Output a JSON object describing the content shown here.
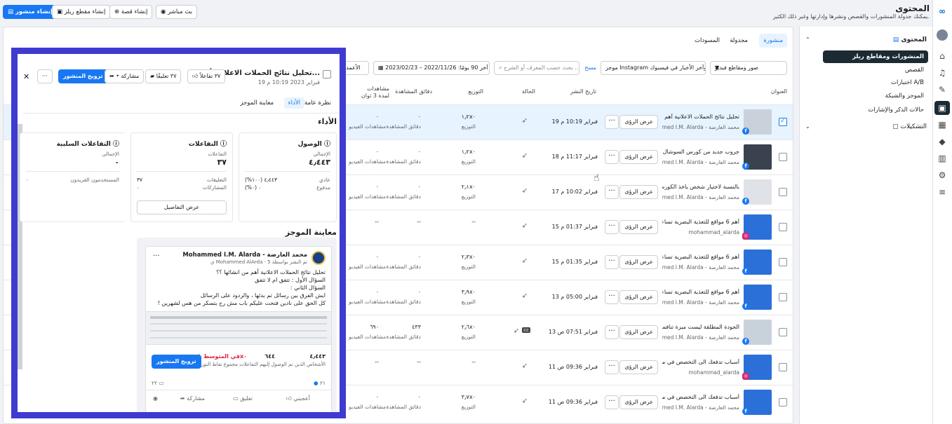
{
  "header": {
    "title": "المحتوى",
    "subtitle": "يمكنك جدولة المنشورات والقصص ونشرها وإدارتها وغير ذلك الكثير.",
    "buttons": {
      "live": "بث مباشر",
      "story": "إنشاء قصة",
      "reel": "إنشاء مقطع ريلز",
      "post": "إنشاء منشور"
    }
  },
  "sidebar": {
    "content_section": "المحتوى",
    "items": [
      "المنشورات ومقاطع ريلز",
      "القصص",
      "اختبارات A/B",
      "الموجز والشبكة",
      "حالات الذكر والإشارات"
    ],
    "collections": "التشكيلات"
  },
  "main": {
    "tabs": [
      "منشورة",
      "مجدولة",
      "المسودات"
    ],
    "filters": {
      "type": "صور ومقاطع فيديو",
      "placement": "موجز Instagram وآخر الأخبار في فيسبوك",
      "clear": "مسح",
      "search_placeholder": "بحث حسب المعرف أو الشرح ...",
      "date_range": "آخر 90 يومًا: 2022/11/26 – 2023/02/23",
      "columns": "الأعمدة"
    },
    "columns": {
      "title": "العنوان",
      "date": "تاريخ النشر",
      "status": "الحالة",
      "reach": "التوزيع",
      "minutes": "دقائق المشاهدة",
      "views": "مشاهدات لمدة 3 ثوان"
    },
    "view_insights": "عرض الرؤى",
    "reach_label": "التوزيع",
    "minutes_label": "دقائق المشاهدة",
    "views_label": "مشاهدات الفيديو",
    "rows": [
      {
        "title": "تحليل نتائج الحملات الاعلانية أهم من...",
        "page": "محمد العارضة - Mohammed I.M. Alarda",
        "date": "19 فبراير 10:19 م",
        "reach": "١٫٢x٠",
        "minutes": "٠",
        "views": "٠"
      },
      {
        "title": "جروب جديد من كورس السوشال ميديـ...",
        "page": "محمد العارضة - Mohammed I.M. Alarda",
        "date": "18 فبراير 11:17 م",
        "reach": "١٫٢x٠",
        "minutes": "٠",
        "views": "٠"
      },
      {
        "title": "بالنسبة لاختيار شخص ياخذ الكورس ...",
        "page": "محمد العارضة - Mohammed I.M. Alarda",
        "date": "17 فبراير 10:02 م",
        "reach": "٢٫١x٠",
        "minutes": "٠",
        "views": "٠"
      },
      {
        "title": "أهم 6 مواقع للتعذية البصرية تساعـ...",
        "page": "mohammad_alarda",
        "date": "15 فبراير 01:37 م",
        "reach": "--",
        "minutes": "--",
        "views": "--"
      },
      {
        "title": "أهم 6 مواقع للتعذية البصرية تساعـ...",
        "page": "محمد العارضة - Mohammed I.M. Alarda",
        "date": "15 فبراير 01:35 م",
        "reach": "٢٫٣x٠",
        "minutes": "٠",
        "views": "٠"
      },
      {
        "title": "أهم 6 مواقع للتعذية البصرية تساعـ...",
        "page": "محمد العارضة - Mohammed I.M. Alarda",
        "date": "13 فبراير 05:00 م",
        "reach": "٣٫٩x٠",
        "minutes": "٠",
        "views": "٠"
      },
      {
        "title": "الجودة المطلقة ليست ميزة تنافسية ...",
        "page": "محمد العارضة - Mohammed I.M. Alarda",
        "date": "13 فبراير 07:51 ص",
        "reach": "٢٫٦x٠",
        "minutes": "٤٣٣",
        "views": "٦٩٠"
      },
      {
        "title": "أسباب تدفعك الى التخصص في مج...",
        "page": "mohammad_alarda",
        "date": "11 فبراير 09:36 ص",
        "reach": "--",
        "minutes": "--",
        "views": "--"
      },
      {
        "title": "أسباب تدفعك الى التخصص في مج...",
        "page": "محمد العارضة - Mohammed I.M. Alarda",
        "date": "11 فبراير 09:36 ص",
        "reach": "٣٫٧x٠",
        "minutes": "٠",
        "views": "٠"
      }
    ]
  },
  "panel": {
    "title": "تحليل نتائج الحملات الاعلانية أه...",
    "date": "19 فبراير 2023 10:19 م",
    "reactions": "٣٧ تفاعلاً",
    "comments": "٣٧ تعليقًا",
    "share": "• مشاركة",
    "boost": "ترويج المنشور",
    "tabs": [
      "نظرة عامة",
      "الأداء",
      "معاينة الموجز"
    ],
    "performance_heading": "الأداء",
    "reach": {
      "title": "الوصول",
      "total_label": "الإجمالي",
      "total": "٤٫٤٤٣",
      "organic_label": "عادي",
      "organic": "٤٫٤٤٣ (١٠٠%)",
      "paid_label": "مدفوع",
      "paid": "٠ (٠%)"
    },
    "engagement": {
      "title": "التفاعلات",
      "total_label": "التفاعلات",
      "total": "٣٧",
      "comments_label": "التعليقات",
      "comments": "٣٧",
      "shares_label": "المشاركات",
      "shares": "٠",
      "details": "عرض التفاصيل"
    },
    "negative": {
      "title": "التفاعلات السلبية",
      "total_label": "الإجمالي",
      "total": "٠",
      "unique_label": "المستخدمون الفريدون",
      "unique": "٠"
    },
    "preview_heading": "معاينة الموجز",
    "post": {
      "author": "محمد العارضة - Mohammed I.M. Alarda",
      "meta": "تم النشر بواسطة Mohammed AlArda · 5 ي",
      "lines": [
        "تحليل نتائج الحملات الاعلانية أهم من انشائها ؟؟",
        "السؤال الأول : تتفق ام لا تتفق",
        "السؤال الثاني :",
        "ايش الفرق بين رسائل تم بدئها ، والردود على الرسائل",
        "كل الحق على نادين فتحت عليكم باب مش رح يتسكر من هس لشهرين !"
      ],
      "stat_reach": "٤٫٤٤٣",
      "stat_eng": "٦٤٤",
      "stat_avg": "في المتوسط ↓ ١٫٢x٠",
      "stat_caption": "الأشخاص الذين تم الوصول إليهم التفاعلات مجموع نقاط التوزيع",
      "boost": "ترويج المنشور",
      "likes": "٢١",
      "comment_count": "٢٢",
      "like": "أعجبني",
      "comment": "تعليق",
      "share": "مشاركة"
    }
  }
}
